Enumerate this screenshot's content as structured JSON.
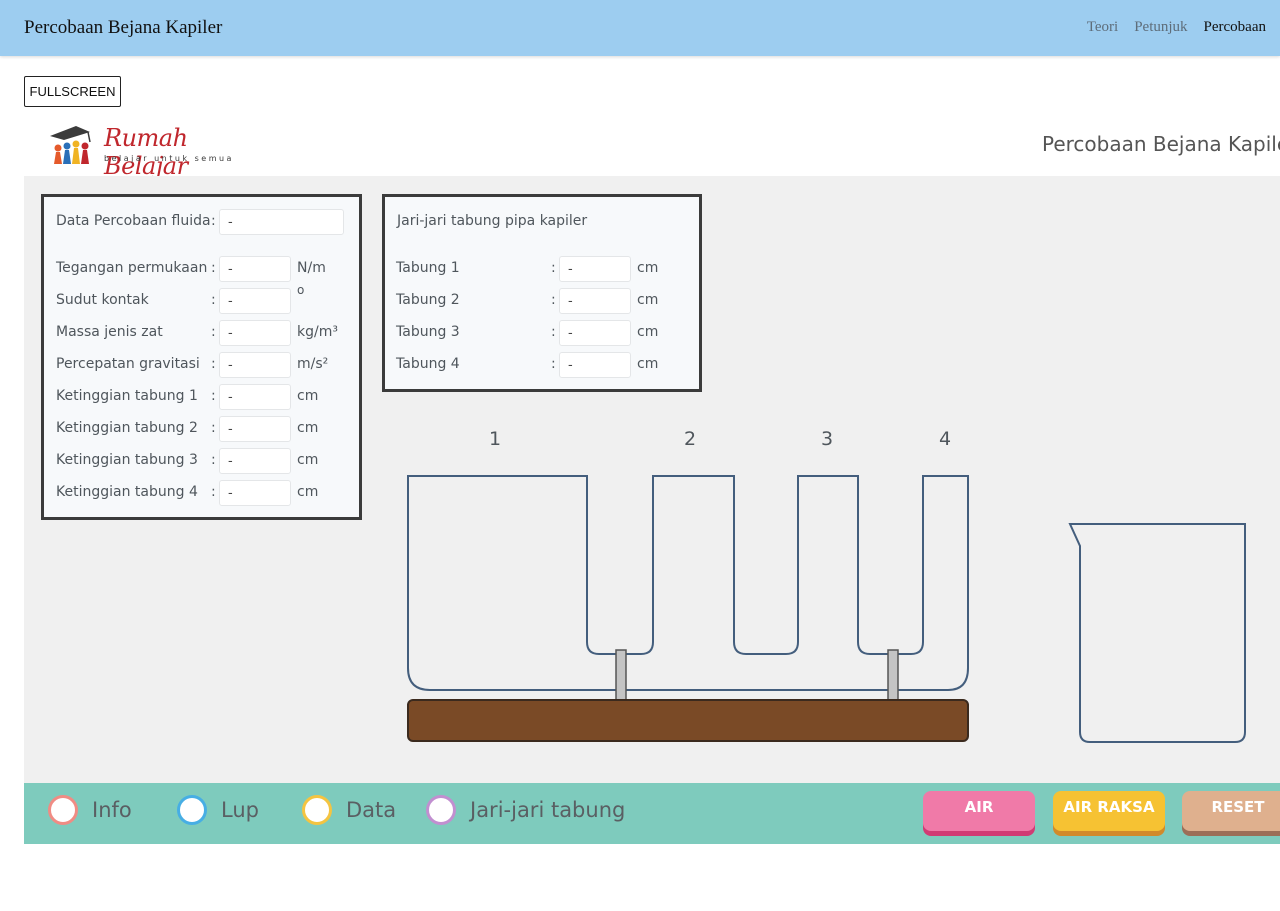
{
  "navbar": {
    "title": "Percobaan Bejana Kapiler",
    "links": [
      "Teori",
      "Petunjuk",
      "Percobaan"
    ]
  },
  "fullscreen_label": "FULLSCREEN",
  "sim": {
    "logo_text": "Rumah Belajar",
    "logo_sub": "belajar untuk semua",
    "title": "Percobaan Bejana Kapiler"
  },
  "data_panel": {
    "fluid_label": "Data Percobaan fluida",
    "fluid_value": "-",
    "rows": [
      {
        "label": "Tegangan permukaan",
        "value": "-",
        "unit": "N/m"
      },
      {
        "label": "Sudut kontak",
        "value": "-",
        "unit": "o"
      },
      {
        "label": "Massa jenis zat",
        "value": "-",
        "unit": "kg/m³"
      },
      {
        "label": "Percepatan gravitasi",
        "value": "-",
        "unit": "m/s²"
      },
      {
        "label": "Ketinggian tabung 1",
        "value": "-",
        "unit": "cm"
      },
      {
        "label": "Ketinggian tabung 2",
        "value": "-",
        "unit": "cm"
      },
      {
        "label": "Ketinggian tabung 3",
        "value": "-",
        "unit": "cm"
      },
      {
        "label": "Ketinggian tabung 4",
        "value": "-",
        "unit": "cm"
      }
    ]
  },
  "radius_panel": {
    "title": "Jari-jari tabung pipa kapiler",
    "rows": [
      {
        "label": "Tabung 1",
        "value": "-",
        "unit": "cm"
      },
      {
        "label": "Tabung 2",
        "value": "-",
        "unit": "cm"
      },
      {
        "label": "Tabung 3",
        "value": "-",
        "unit": "cm"
      },
      {
        "label": "Tabung 4",
        "value": "-",
        "unit": "cm"
      }
    ]
  },
  "tubes": [
    "1",
    "2",
    "3",
    "4"
  ],
  "bottom_bar": {
    "options": [
      {
        "label": "Info",
        "color": "#f08c84"
      },
      {
        "label": "Lup",
        "color": "#47aee4"
      },
      {
        "label": "Data",
        "color": "#f4c441"
      },
      {
        "label": "Jari-jari tabung",
        "color": "#c18fd0"
      }
    ],
    "buttons": [
      {
        "label": "AIR",
        "color": "#f07aa8",
        "shadow": "#d13b74"
      },
      {
        "label": "AIR RAKSA",
        "color": "#f6c233",
        "shadow": "#d28a2a"
      },
      {
        "label": "RESET",
        "color": "#dfb08e",
        "shadow": "#9c6e57"
      }
    ]
  },
  "colors": {
    "navbar": "#9dcdf0",
    "stage": "#f0f0f0",
    "tube_outline": "#445e7d",
    "base": "#7a4a26",
    "bottom_bar": "#7ecbbd"
  }
}
